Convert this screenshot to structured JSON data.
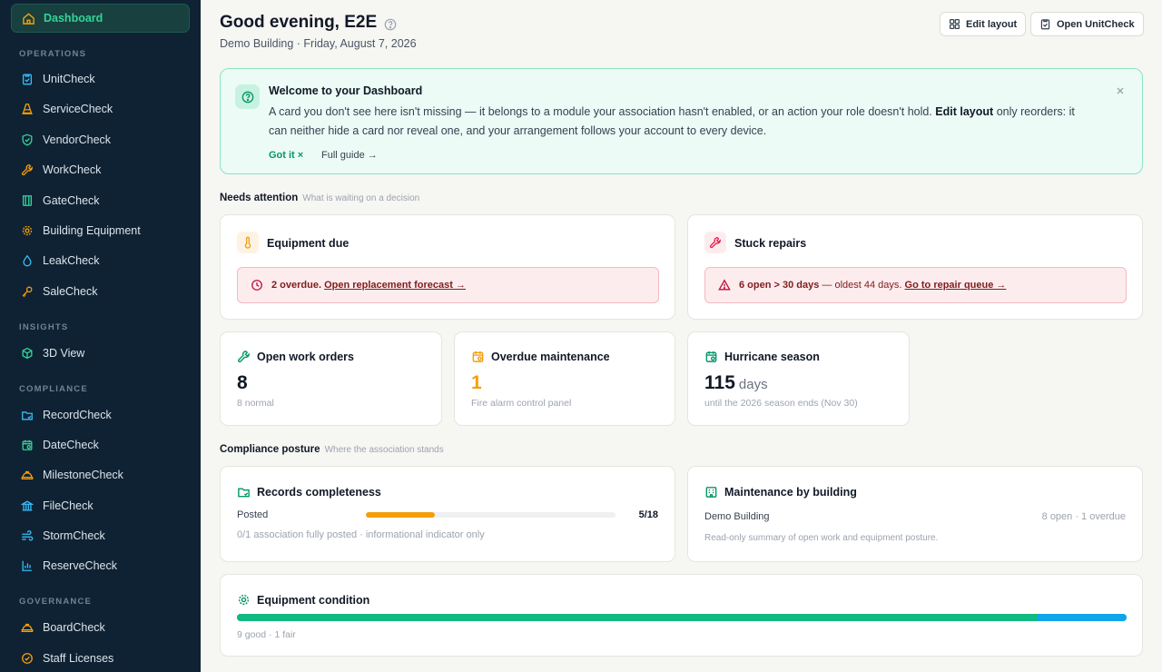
{
  "sidebar": {
    "active": {
      "label": "Dashboard",
      "icon": "home-icon"
    },
    "sections": {
      "operations": "OPERATIONS",
      "insights": "INSIGHTS",
      "compliance": "COMPLIANCE",
      "governance": "GOVERNANCE"
    },
    "operations_items": [
      {
        "label": "UnitCheck",
        "icon": "clipboard-icon",
        "color": "#38bdf8"
      },
      {
        "label": "ServiceCheck",
        "icon": "cone-icon",
        "color": "#f59e0b"
      },
      {
        "label": "VendorCheck",
        "icon": "shield-icon",
        "color": "#34d399"
      },
      {
        "label": "WorkCheck",
        "icon": "wrench-icon",
        "color": "#f59e0b"
      },
      {
        "label": "GateCheck",
        "icon": "gate-icon",
        "color": "#34d399"
      },
      {
        "label": "Building Equipment",
        "icon": "gear-icon",
        "color": "#f59e0b"
      },
      {
        "label": "LeakCheck",
        "icon": "droplet-icon",
        "color": "#38bdf8"
      },
      {
        "label": "SaleCheck",
        "icon": "key-icon",
        "color": "#f59e0b"
      }
    ],
    "insights_items": [
      {
        "label": "3D View",
        "icon": "cube-icon",
        "color": "#34d399"
      }
    ],
    "compliance_items": [
      {
        "label": "RecordCheck",
        "icon": "folder-icon",
        "color": "#38bdf8"
      },
      {
        "label": "DateCheck",
        "icon": "calendar-icon",
        "color": "#34d399"
      },
      {
        "label": "MilestoneCheck",
        "icon": "hardhat-icon",
        "color": "#f59e0b"
      },
      {
        "label": "FileCheck",
        "icon": "bank-icon",
        "color": "#38bdf8"
      },
      {
        "label": "StormCheck",
        "icon": "wind-icon",
        "color": "#38bdf8"
      },
      {
        "label": "ReserveCheck",
        "icon": "bar-chart-icon",
        "color": "#38bdf8"
      }
    ],
    "governance_items": [
      {
        "label": "BoardCheck",
        "icon": "hardhat-icon",
        "color": "#f59e0b"
      },
      {
        "label": "Staff Licenses",
        "icon": "badge-check-icon",
        "color": "#f59e0b"
      }
    ]
  },
  "header": {
    "greeting": "Good evening, E2E",
    "subline": "Demo Building · Friday, August 7, 2026",
    "edit_layout": "Edit layout",
    "open_unitcheck": "Open UnitCheck"
  },
  "welcome": {
    "title": "Welcome to your Dashboard",
    "body_1": "A card you don't see here isn't missing — it belongs to a module your association hasn't enabled, or an action your role doesn't hold.",
    "body_bold": "Edit layout",
    "body_2": "only reorders: it can neither hide a card nor reveal one, and your arrangement follows your account to every device.",
    "got_it": "Got it ×",
    "full_guide": "Full guide →"
  },
  "needs_attention": {
    "title": "Needs attention",
    "subtitle": "What is waiting on a decision",
    "equipment_due": {
      "title": "Equipment due",
      "alert_bold": "2 overdue.",
      "alert_link": "Open replacement forecast →"
    },
    "stuck_repairs": {
      "title": "Stuck repairs",
      "alert_bold": "6 open > 30 days",
      "alert_text": "— oldest 44 days.",
      "alert_link": "Go to repair queue →"
    }
  },
  "stats": {
    "open_work_orders": {
      "title": "Open work orders",
      "value": "8",
      "note": "8 normal"
    },
    "overdue_maintenance": {
      "title": "Overdue maintenance",
      "value": "1",
      "note": "Fire alarm control panel",
      "color": "#f59e0b"
    },
    "hurricane_season": {
      "title": "Hurricane season",
      "value": "115",
      "unit": "days",
      "note": "until the 2026 season ends (Nov 30)"
    }
  },
  "compliance": {
    "title": "Compliance posture",
    "subtitle": "Where the association stands",
    "records": {
      "title": "Records completeness",
      "row_label": "Posted",
      "row_value": "5/18",
      "progress": 0.2778,
      "note": "0/1 association fully posted · informational indicator only"
    },
    "maintenance": {
      "title": "Maintenance by building",
      "building": "Demo Building",
      "building_status": "8 open · 1 overdue",
      "note": "Read-only summary of open work and equipment posture."
    }
  },
  "equipment_condition": {
    "title": "Equipment condition",
    "good": 9,
    "fair": 1,
    "note": "9 good · 1 fair",
    "good_color": "#10b981",
    "fair_color": "#0ea5e9"
  }
}
